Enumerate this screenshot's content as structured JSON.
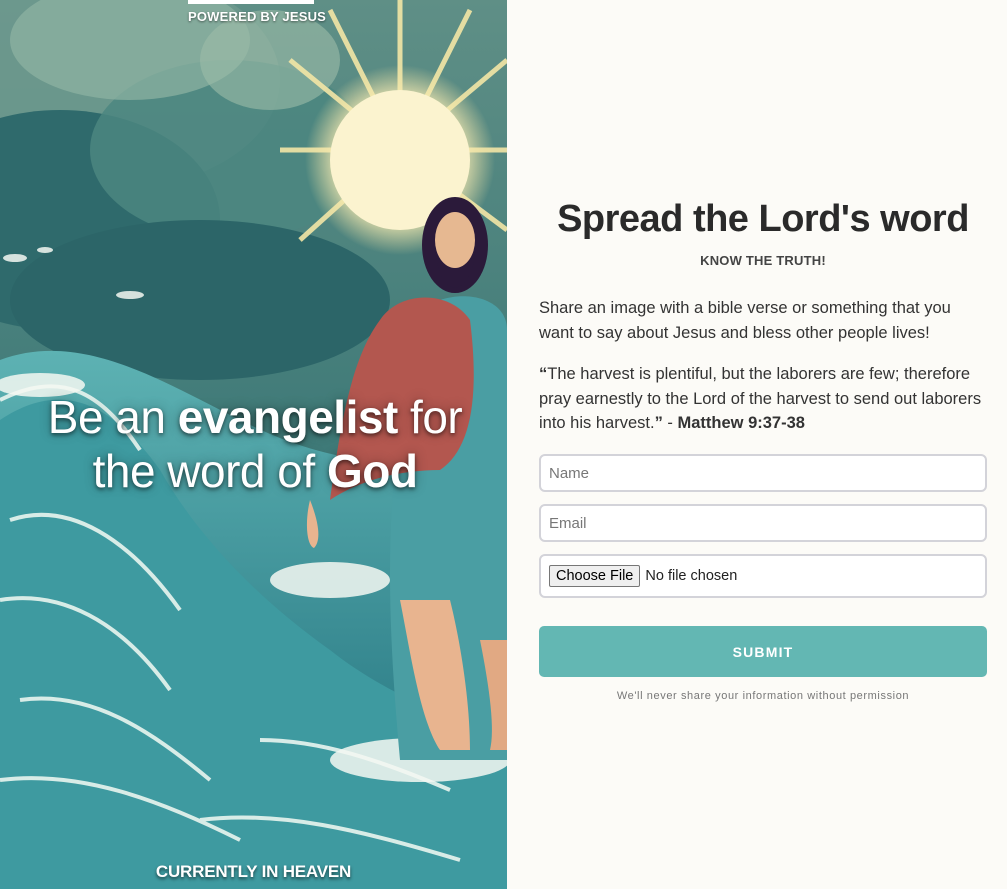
{
  "hero": {
    "powered_by": "POWERED BY JESUS",
    "tagline_part1": "Be an ",
    "tagline_bold1": "evangelist",
    "tagline_part2": " for the word of ",
    "tagline_bold2": "God",
    "location": "CURRENTLY IN HEAVEN"
  },
  "form": {
    "title": "Spread the Lord's word",
    "subtitle": "KNOW THE TRUTH!",
    "intro": "Share an image with a bible verse or something that you want to say about Jesus and bless other people lives!",
    "quote_open": "“",
    "quote_text": "The harvest is plentiful, but the laborers are few; therefore pray earnestly to the Lord of the harvest to send out laborers into his harvest.",
    "quote_close": "”",
    "quote_sep": " - ",
    "quote_ref": "Matthew 9:37-38",
    "name_placeholder": "Name",
    "email_placeholder": "Email",
    "file_button": "Choose File",
    "file_status": "No file chosen",
    "submit_label": "SUBMIT",
    "privacy": "We'll never share your information without permission"
  },
  "colors": {
    "accent": "#63b7b3",
    "background": "#fcfbf7",
    "title": "#2a2a2a"
  }
}
